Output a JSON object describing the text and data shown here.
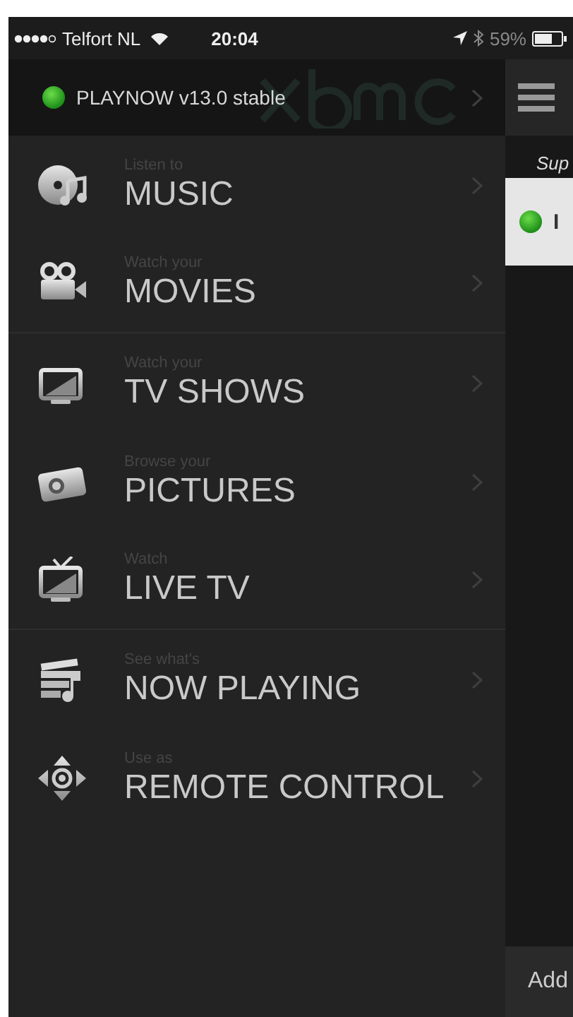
{
  "status_bar": {
    "carrier": "Telfort NL",
    "time": "20:04",
    "battery": "59%"
  },
  "drawer": {
    "host": {
      "name": "PLAYNOW v13.0 stable",
      "connected": true
    },
    "sections": [
      [
        {
          "kind": "music",
          "subtitle": "Listen to",
          "title": "MUSIC"
        },
        {
          "kind": "movies",
          "subtitle": "Watch your",
          "title": "MOVIES"
        }
      ],
      [
        {
          "kind": "tv",
          "subtitle": "Watch your",
          "title": "TV SHOWS"
        },
        {
          "kind": "pictures",
          "subtitle": "Browse your",
          "title": "PICTURES"
        },
        {
          "kind": "livetv",
          "subtitle": "Watch",
          "title": "LIVE TV"
        }
      ],
      [
        {
          "kind": "nowplaying",
          "subtitle": "See what's",
          "title": "NOW PLAYING"
        },
        {
          "kind": "remote",
          "subtitle": "Use as",
          "title": "REMOTE CONTROL"
        }
      ]
    ]
  },
  "main": {
    "section_label": "Sup",
    "host_card": {
      "connected": true,
      "label": "I"
    },
    "footer_button": "Add"
  }
}
